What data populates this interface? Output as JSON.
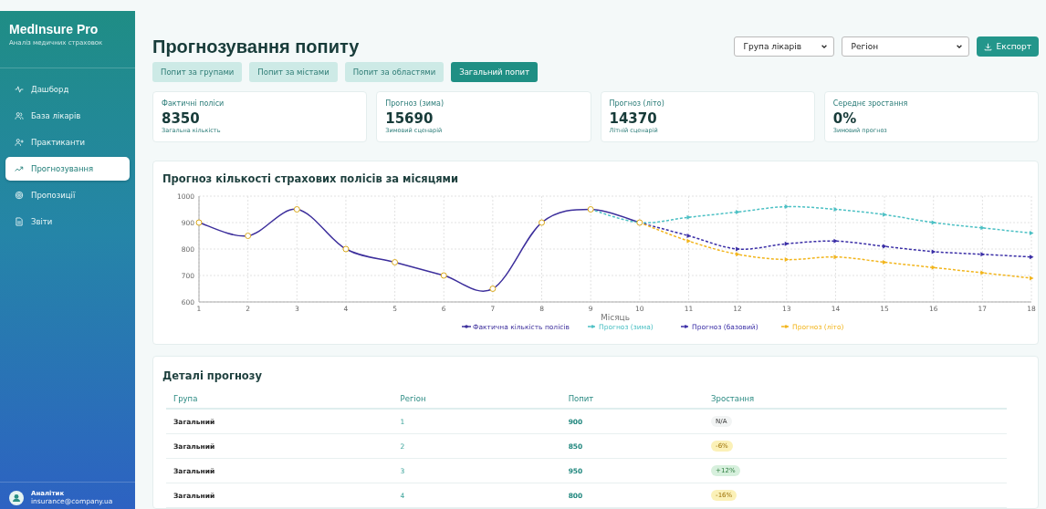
{
  "sidebar": {
    "brand": "MedInsure Pro",
    "subtitle": "Аналіз медичних страховок",
    "items": [
      {
        "label": "Дашборд",
        "selected": false
      },
      {
        "label": "База лікарів",
        "selected": false
      },
      {
        "label": "Практиканти",
        "selected": false
      },
      {
        "label": "Прогнозування",
        "selected": true
      },
      {
        "label": "Пропозиції",
        "selected": false
      },
      {
        "label": "Звіти",
        "selected": false
      }
    ],
    "user": {
      "name": "Аналітик",
      "email": "insurance@company.ua"
    }
  },
  "header": {
    "title": "Прогнозування попиту",
    "filters": [
      {
        "value": "Група лікарів"
      },
      {
        "value": "Регіон"
      }
    ],
    "export": "Експорт"
  },
  "tabs": [
    {
      "label": "Попит за групами",
      "selected": false
    },
    {
      "label": "Попит за містами",
      "selected": false
    },
    {
      "label": "Попит за областями",
      "selected": false
    },
    {
      "label": "Загальний попит",
      "selected": true
    }
  ],
  "stats": [
    {
      "label": "Фактичні поліси",
      "value": "8350",
      "note": "Загальна кількість"
    },
    {
      "label": "Прогноз (зима)",
      "value": "15690",
      "note": "Зимовий сценарій"
    },
    {
      "label": "Прогноз (літо)",
      "value": "14370",
      "note": "Літній сценарій"
    },
    {
      "label": "Середнє зростання",
      "value": "0%",
      "note": "Зимовий прогноз"
    }
  ],
  "chart": {
    "title": "Прогноз кількості страхових полісів за місяцями",
    "chart_data": {
      "type": "line",
      "xlabel": "Місяць",
      "x": [
        1,
        2,
        3,
        4,
        5,
        6,
        7,
        8,
        9,
        10,
        11,
        12,
        13,
        14,
        15,
        16,
        17,
        18
      ],
      "xlim": [
        1,
        18
      ],
      "grid": true,
      "legend": true,
      "ylim": [
        600,
        1000
      ],
      "yticks": [
        600,
        700,
        800,
        900,
        1000
      ],
      "xticks": [
        1,
        2,
        3,
        4,
        5,
        6,
        7,
        8,
        9,
        10,
        11,
        12,
        13,
        14,
        15,
        16,
        17,
        18
      ],
      "series": [
        {
          "name": "Фактична кількість полісів",
          "color": "#3d2f9c",
          "line_style": "solid",
          "marker": "circle",
          "values": [
            900,
            850,
            950,
            800,
            750,
            700,
            650,
            900,
            950,
            900,
            null,
            null,
            null,
            null,
            null,
            null,
            null,
            null
          ]
        },
        {
          "name": "Прогноз (зима)",
          "color": "#4cc0c4",
          "line_style": "dashed",
          "marker": "triangle",
          "values": [
            null,
            null,
            null,
            null,
            null,
            null,
            null,
            null,
            950,
            900,
            920,
            940,
            960,
            950,
            930,
            900,
            880,
            860
          ]
        },
        {
          "name": "Прогноз (базовий)",
          "color": "#3a2ea6",
          "line_style": "dashed",
          "marker": "triangle",
          "values": [
            null,
            null,
            null,
            null,
            null,
            null,
            null,
            null,
            null,
            900,
            850,
            800,
            820,
            830,
            810,
            790,
            780,
            770
          ]
        },
        {
          "name": "Прогноз (літо)",
          "color": "#f2b51c",
          "line_style": "dashed",
          "marker": "triangle",
          "values": [
            null,
            null,
            null,
            null,
            null,
            null,
            null,
            null,
            null,
            900,
            830,
            780,
            760,
            770,
            750,
            730,
            710,
            690
          ]
        }
      ]
    }
  },
  "details": {
    "title": "Деталі прогнозу",
    "columns": [
      "Група",
      "Регіон",
      "Попит",
      "Зростання"
    ],
    "rows": [
      {
        "group": "Загальний",
        "region": "1",
        "demand": "900",
        "growth": "N/A",
        "kind": "none"
      },
      {
        "group": "Загальний",
        "region": "2",
        "demand": "850",
        "growth": "-6%",
        "kind": "down"
      },
      {
        "group": "Загальний",
        "region": "3",
        "demand": "950",
        "growth": "+12%",
        "kind": "up"
      },
      {
        "group": "Загальний",
        "region": "4",
        "demand": "800",
        "growth": "-16%",
        "kind": "down"
      }
    ]
  }
}
